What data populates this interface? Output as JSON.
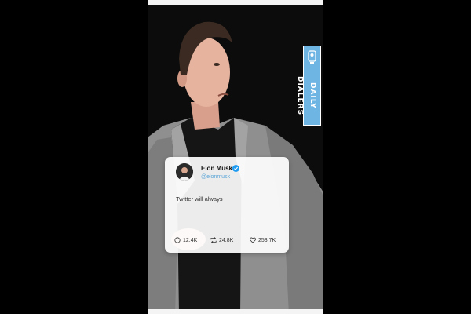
{
  "badge": {
    "label": "DAILY DIALERS"
  },
  "tweet": {
    "author_name": "Elon Musk",
    "author_handle": "@elonmusk",
    "text": "Twitter will always",
    "stats": {
      "replies": "12.4K",
      "retweets": "24.8K",
      "likes": "253.7K"
    }
  },
  "colors": {
    "badge": "#6fb5e3",
    "handle": "#5aa4d6",
    "verified": "#1d9bf0"
  },
  "icons": [
    "verified-badge-icon",
    "reply-icon",
    "retweet-icon",
    "like-icon",
    "pointing-hand-icon"
  ]
}
